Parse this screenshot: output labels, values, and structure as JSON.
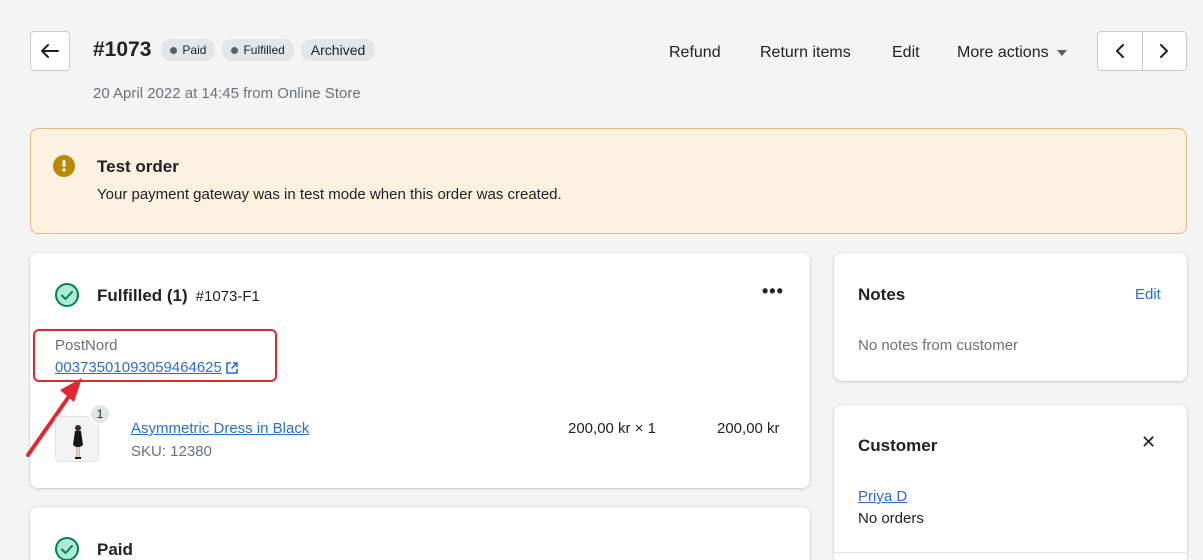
{
  "header": {
    "order_number": "#1073",
    "badges": [
      "Paid",
      "Fulfilled",
      "Archived"
    ],
    "subtitle": "20 April 2022 at 14:45 from Online Store",
    "actions": {
      "refund": "Refund",
      "return_items": "Return items",
      "edit": "Edit",
      "more_actions": "More actions"
    }
  },
  "banner": {
    "title": "Test order",
    "text": "Your payment gateway was in test mode when this order was created."
  },
  "fulfilled_card": {
    "title": "Fulfilled (1)",
    "fulfillment_id": "#1073-F1",
    "carrier": "PostNord",
    "tracking_number": "00373501093059464625",
    "item": {
      "quantity": "1",
      "name": "Asymmetric Dress in Black",
      "sku": "SKU: 12380",
      "price_qty": "200,00 kr × 1",
      "total": "200,00 kr"
    }
  },
  "paid_card": {
    "title": "Paid"
  },
  "notes_card": {
    "title": "Notes",
    "edit": "Edit",
    "text": "No notes from customer"
  },
  "customer_card": {
    "title": "Customer",
    "name": "Priya D",
    "orders": "No orders"
  },
  "colors": {
    "link": "#2c6ecb",
    "success": "#007f5f",
    "warning_bg": "#fdf1e2",
    "warning_border": "#e1b878",
    "highlight": "#e0282e"
  },
  "icons": [
    "back-arrow-icon",
    "chevron-left-icon",
    "chevron-right-icon",
    "caret-down-icon",
    "warning-icon",
    "check-circle-icon",
    "external-link-icon",
    "more-horizontal-icon",
    "close-icon"
  ]
}
